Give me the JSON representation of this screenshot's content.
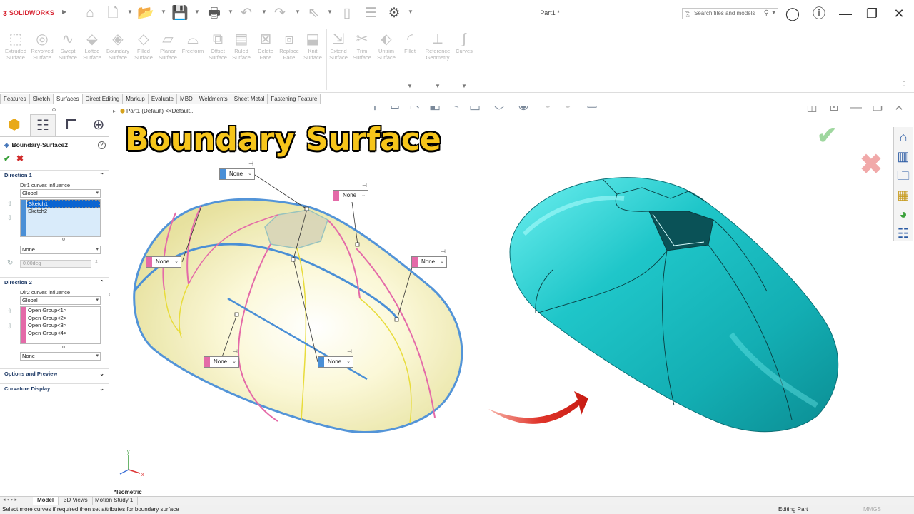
{
  "app": {
    "brand_icon": "3ds-logo",
    "brand_name": "SOLIDWORKS",
    "document_title": "Part1 *",
    "search_placeholder": "Search files and models"
  },
  "toolbar_icons": [
    "home-icon",
    "new-file-icon",
    "open-icon",
    "save-icon",
    "print-icon",
    "undo-icon",
    "redo-icon",
    "select-icon",
    "rebuild-icon",
    "file-properties-icon",
    "options-gear-icon"
  ],
  "command_manager": {
    "groups": [
      {
        "items": [
          {
            "label": "Extruded Surface",
            "icon": "extruded-surface-icon"
          },
          {
            "label": "Revolved Surface",
            "icon": "revolved-surface-icon"
          },
          {
            "label": "Swept Surface",
            "icon": "swept-surface-icon"
          },
          {
            "label": "Lofted Surface",
            "icon": "lofted-surface-icon"
          },
          {
            "label": "Boundary Surface",
            "icon": "boundary-surface-icon"
          },
          {
            "label": "Filled Surface",
            "icon": "filled-surface-icon"
          },
          {
            "label": "Planar Surface",
            "icon": "planar-surface-icon"
          },
          {
            "label": "Freeform",
            "icon": "freeform-icon"
          },
          {
            "label": "Offset Surface",
            "icon": "offset-surface-icon"
          },
          {
            "label": "Ruled Surface",
            "icon": "ruled-surface-icon"
          },
          {
            "label": "Delete Face",
            "icon": "delete-face-icon"
          },
          {
            "label": "Replace Face",
            "icon": "replace-face-icon"
          },
          {
            "label": "Knit Surface",
            "icon": "knit-surface-icon"
          }
        ]
      },
      {
        "items": [
          {
            "label": "Extend Surface",
            "icon": "extend-surface-icon"
          },
          {
            "label": "Trim Surface",
            "icon": "trim-surface-icon"
          },
          {
            "label": "Untrim Surface",
            "icon": "untrim-surface-icon"
          },
          {
            "label": "Fillet",
            "icon": "fillet-icon"
          }
        ]
      },
      {
        "items": [
          {
            "label": "Reference Geometry",
            "icon": "reference-geometry-icon"
          },
          {
            "label": "Curves",
            "icon": "curves-icon"
          }
        ]
      }
    ]
  },
  "tabs": [
    "Features",
    "Sketch",
    "Surfaces",
    "Direct Editing",
    "Markup",
    "Evaluate",
    "MBD",
    "Weldments",
    "Sheet Metal",
    "Fastening Feature"
  ],
  "active_tab": "Surfaces",
  "property_manager": {
    "feature_name": "Boundary-Surface2",
    "help": "?",
    "direction1": {
      "title": "Direction 1",
      "influence_label": "Dir1 curves influence",
      "influence_value": "Global",
      "curves": [
        "Sketch1",
        "Sketch2"
      ],
      "selected_curve": "Sketch1",
      "tangency": "None",
      "angle_value": "0.00deg"
    },
    "direction2": {
      "title": "Direction 2",
      "influence_label": "Dir2 curves influence",
      "influence_value": "Global",
      "curves": [
        "Open Group<1>",
        "Open Group<2>",
        "Open Group<3>",
        "Open Group<4>"
      ],
      "tangency": "None"
    },
    "options_title": "Options and Preview",
    "curvature_title": "Curvature Display",
    "colors": {
      "direction1": "#4a8fd6",
      "direction2": "#e46aa8",
      "list_selection": "#0a64d1"
    }
  },
  "graphics": {
    "tree_breadcrumb": "Part1 (Default) <<Default...",
    "overlay_title": "Boundary Surface",
    "view_label": "*Isometric",
    "callouts": [
      {
        "text": "None",
        "color": "#4a8fd6"
      },
      {
        "text": "None",
        "color": "#e46aa8"
      },
      {
        "text": "None",
        "color": "#e46aa8"
      },
      {
        "text": "None",
        "color": "#e46aa8"
      },
      {
        "text": "None",
        "color": "#e46aa8"
      },
      {
        "text": "None",
        "color": "#4a8fd6"
      }
    ],
    "triad_labels": {
      "y": "y",
      "x": "x"
    },
    "colors": {
      "preview_surface": "#f4f0b8",
      "result_surface": "#1fc6c9",
      "title_fill": "#f6c51a",
      "arrow": "#e0352b"
    }
  },
  "bottom_tabs": [
    "Model",
    "3D Views",
    "Motion Study 1"
  ],
  "active_bottom_tab": "Model",
  "status": {
    "message": "Select more curves if required then set attributes for boundary surface",
    "mode": "Editing Part",
    "units": "MMGS"
  }
}
